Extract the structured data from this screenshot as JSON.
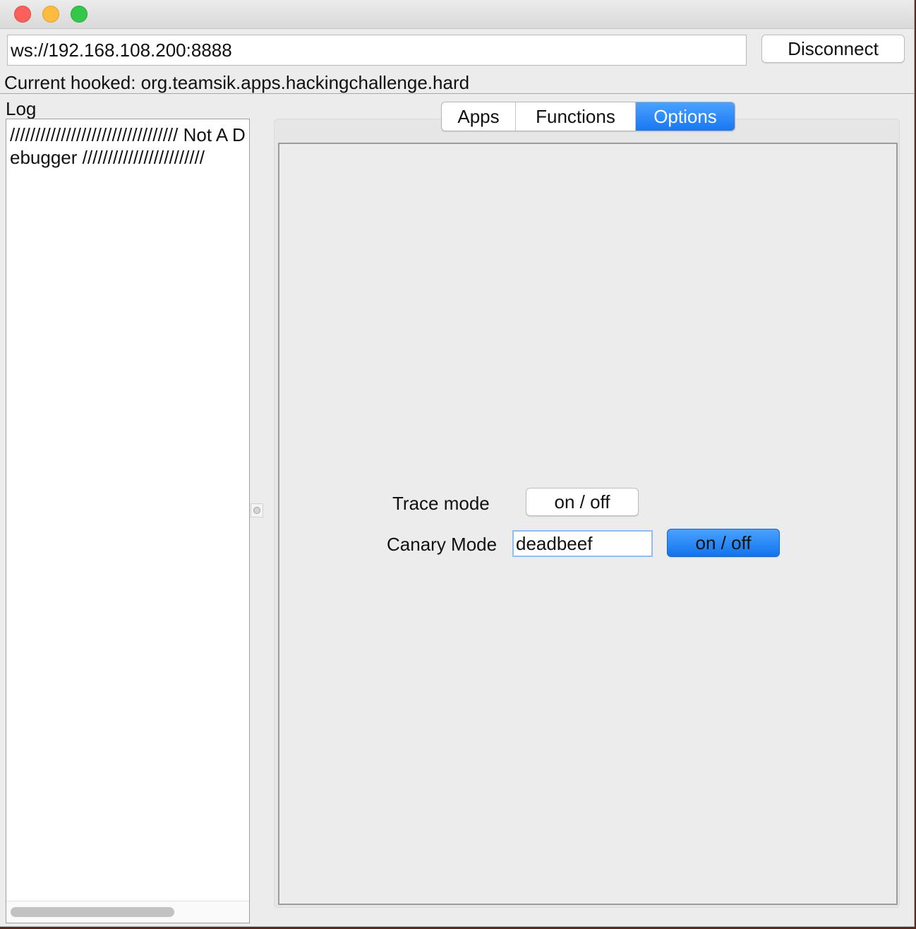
{
  "window": {
    "controls": [
      "close",
      "minimize",
      "zoom"
    ]
  },
  "connection": {
    "url": "ws://192.168.108.200:8888",
    "disconnect_label": "Disconnect",
    "hooked_text": "Current hooked: org.teamsik.apps.hackingchallenge.hard"
  },
  "log": {
    "label": "Log",
    "text": "///////////////////////////////// Not A Debugger ////////////////////////"
  },
  "tabs": [
    {
      "label": "Apps",
      "selected": false
    },
    {
      "label": "Functions",
      "selected": false
    },
    {
      "label": "Options",
      "selected": true
    }
  ],
  "options": {
    "trace_label": "Trace mode",
    "trace_button_label": "on / off",
    "canary_label": "Canary Mode",
    "canary_value": "deadbeef",
    "canary_button_label": "on / off"
  },
  "colors": {
    "accent": "#1877f2",
    "background": "#ececec"
  }
}
